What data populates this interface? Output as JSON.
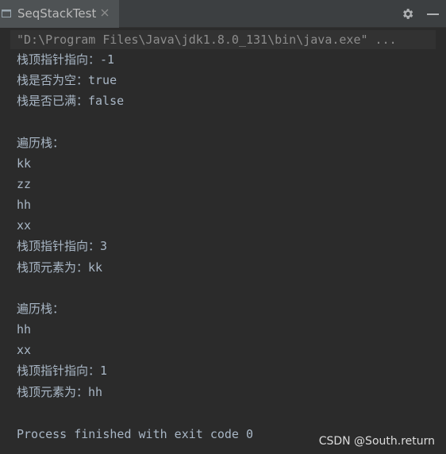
{
  "tab": {
    "title": "SeqStackTest",
    "icon": "console-icon"
  },
  "toolbar": {
    "settings_icon": "gear-icon",
    "minimize_icon": "minimize-icon"
  },
  "console": {
    "command": "\"D:\\Program Files\\Java\\jdk1.8.0_131\\bin\\java.exe\" ...",
    "lines": [
      "栈顶指针指向：-1",
      "栈是否为空：true",
      "栈是否已满：false",
      "",
      "遍历栈：",
      "kk",
      "zz",
      "hh",
      "xx",
      "栈顶指针指向：3",
      "栈顶元素为：kk",
      "",
      "遍历栈：",
      "hh",
      "xx",
      "栈顶指针指向：1",
      "栈顶元素为：hh",
      "",
      "Process finished with exit code 0"
    ]
  },
  "watermark": "CSDN @South.return",
  "colors": {
    "background": "#2b2b2b",
    "text": "#a9b7c6",
    "command_text": "#8d8d8d",
    "tab_bar": "#3c3f41"
  }
}
